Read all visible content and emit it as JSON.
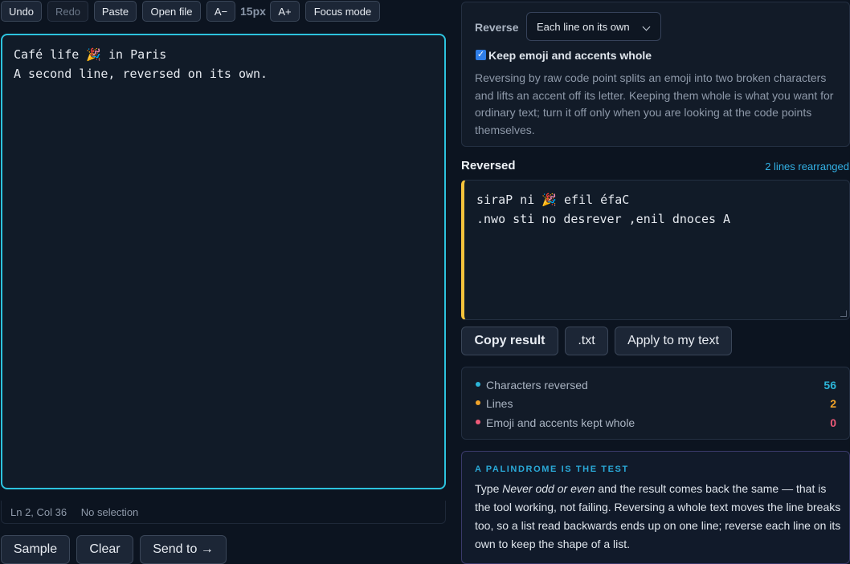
{
  "toolbar": {
    "undo": "Undo",
    "redo": "Redo",
    "paste": "Paste",
    "open_file": "Open file",
    "font_decrease": "A−",
    "font_size": "15px",
    "font_increase": "A+",
    "focus_mode": "Focus mode"
  },
  "editor": {
    "lines": [
      "Café life 🎉 in Paris",
      "A second line, reversed on its own."
    ]
  },
  "status": {
    "position": "Ln 2, Col 36",
    "selection": "No selection"
  },
  "bottom_actions": {
    "sample": "Sample",
    "clear": "Clear",
    "send_to": "Send to →"
  },
  "options": {
    "reverse_label": "Reverse",
    "reverse_mode": "Each line on its own",
    "keep_whole_label": "Keep emoji and accents whole",
    "keep_whole_checked": true,
    "help": "Reversing by raw code point splits an emoji into two broken characters and lifts an accent off its letter. Keeping them whole is what you want for ordinary text; turn it off only when you are looking at the code points themselves."
  },
  "output": {
    "title": "Reversed",
    "badge": "2 lines rearranged",
    "lines": [
      "siraP ni 🎉 efil éfaC",
      ".nwo sti no desrever ,enil dnoces A"
    ]
  },
  "output_actions": {
    "copy": "Copy result",
    "txt": ".txt",
    "apply": "Apply to my text"
  },
  "stats": [
    {
      "label": "Characters reversed",
      "value": "56",
      "color": "#2cb5d8"
    },
    {
      "label": "Lines",
      "value": "2",
      "color": "#f0a329"
    },
    {
      "label": "Emoji and accents kept whole",
      "value": "0",
      "color": "#ef5a78"
    }
  ],
  "tip": {
    "heading": "A PALINDROME IS THE TEST",
    "body_pre": "Type ",
    "body_em": "Never odd or even",
    "body_post": " and the result comes back the same — that is the tool working, not failing. Reversing a whole text moves the line breaks too, so a list read backwards ends up on one line; reverse each line on its own to keep the shape of a list."
  }
}
